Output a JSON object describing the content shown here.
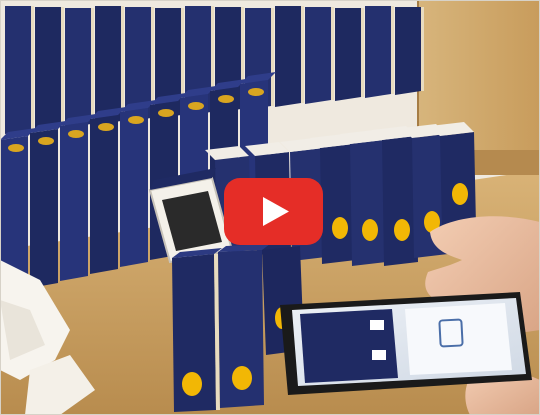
{
  "video": {
    "play_button_color": "#e52d27",
    "play_icon": "play-triangle-icon"
  },
  "colors": {
    "cardboard": "#c9a064",
    "box_blue": "#1f2a63",
    "box_edge": "#e8dcc0",
    "label_yellow": "#f2b705",
    "phone_screen": "#dfe6ef",
    "wall": "#f3efe8"
  }
}
